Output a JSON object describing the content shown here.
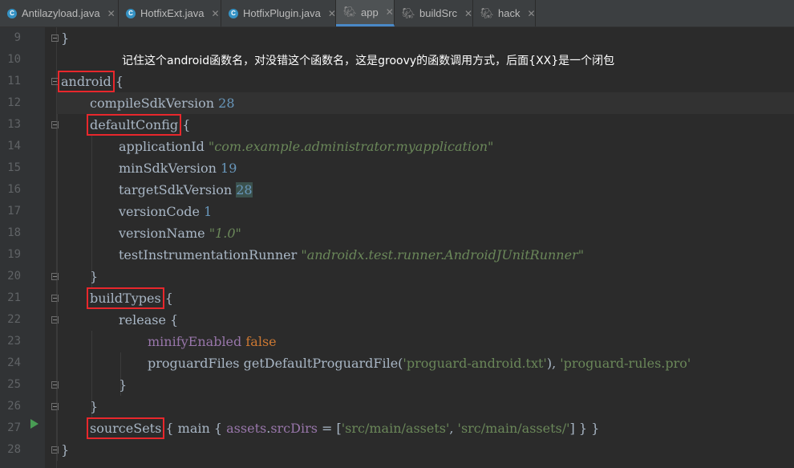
{
  "tabs": [
    {
      "label": "Antilazyload.java",
      "icon": "java-class-icon"
    },
    {
      "label": "HotfixExt.java",
      "icon": "java-class-icon"
    },
    {
      "label": "HotfixPlugin.java",
      "icon": "java-class-icon"
    },
    {
      "label": "app",
      "icon": "gradle-icon",
      "active": true
    },
    {
      "label": "buildSrc",
      "icon": "gradle-icon"
    },
    {
      "label": "hack",
      "icon": "gradle-icon"
    }
  ],
  "line_numbers": [
    "9",
    "10",
    "11",
    "12",
    "13",
    "14",
    "15",
    "16",
    "17",
    "18",
    "19",
    "20",
    "21",
    "22",
    "23",
    "24",
    "25",
    "26",
    "27",
    "28"
  ],
  "annotation": "记住这个android函数名，对没错这个函数名，这是groovy的函数调用方式，后面{XX}是一个闭包",
  "code": {
    "l9": "}",
    "l11_name": "android",
    "l11_brace": " {",
    "l12_key": "compileSdkVersion ",
    "l12_val": "28",
    "l13_name": "defaultConfig",
    "l13_brace": " {",
    "l14_key": "applicationId ",
    "l14_val": "\"com.example.administrator.myapplication\"",
    "l15_key": "minSdkVersion ",
    "l15_val": "19",
    "l16_key": "targetSdkVersion ",
    "l16_val": "28",
    "l17_key": "versionCode ",
    "l17_val": "1",
    "l18_key": "versionName ",
    "l18_val": "\"1.0\"",
    "l19_key": "testInstrumentationRunner ",
    "l19_val": "\"androidx.test.runner.AndroidJUnitRunner\"",
    "l20": "}",
    "l21_name": "buildTypes",
    "l21_brace": " {",
    "l22": "release {",
    "l23_key": "minifyEnabled ",
    "l23_val": "false",
    "l24_key": "proguardFiles getDefaultProguardFile(",
    "l24_val1": "'proguard-android.txt'",
    "l24_mid": "), ",
    "l24_val2": "'proguard-rules.pro'",
    "l25": "}",
    "l26": "}",
    "l27_name": "sourceSets",
    "l27_a": " { main { ",
    "l27_prop1": "assets",
    "l27_dot": ".",
    "l27_prop2": "srcDirs",
    "l27_eq": " = [",
    "l27_s1": "'src/main/assets'",
    "l27_comma": ", ",
    "l27_s2": "'src/main/assets/'",
    "l27_end": "] } }",
    "l28": "}"
  },
  "colors": {
    "background": "#2b2b2b",
    "keyword": "#cc7832",
    "number": "#6897bb",
    "string": "#6a8759",
    "property": "#9876aa",
    "highlight_box": "#e8272c",
    "active_tab_underline": "#4a88c7"
  }
}
